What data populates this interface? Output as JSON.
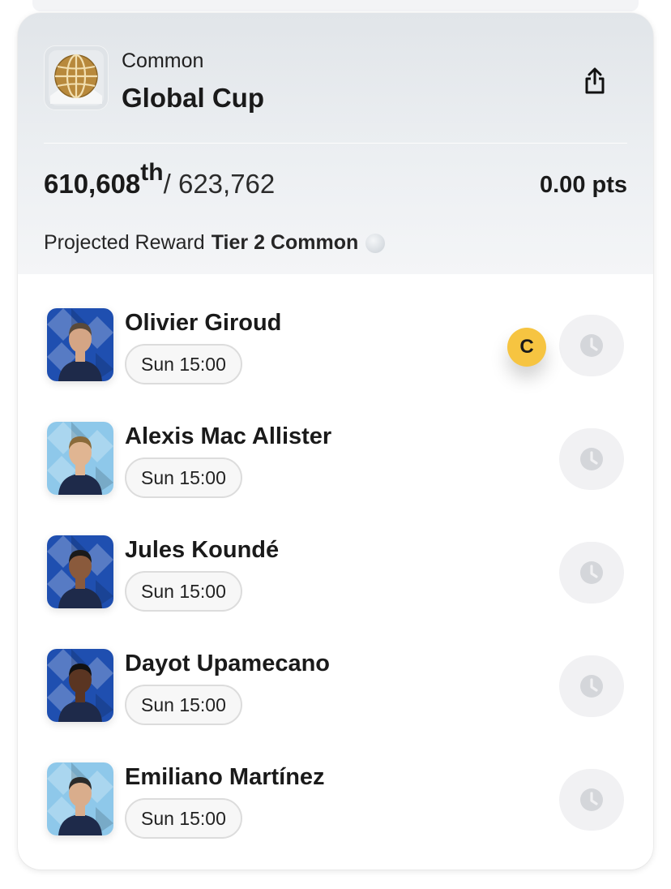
{
  "competition": {
    "rarity": "Common",
    "title": "Global Cup",
    "rank": "610,608",
    "rank_suffix": "th",
    "rank_total": "/ 623,762",
    "points": "0.00 pts",
    "reward_label": "Projected Reward",
    "reward_tier": "Tier 2 Common",
    "logo_icon": "globe-trophy-icon",
    "share_icon": "share-icon"
  },
  "players": [
    {
      "name": "Olivier Giroud",
      "kickoff": "Sun 15:00",
      "captain": "C",
      "card_color": "#1f4fb0",
      "status_icon": "clock-icon"
    },
    {
      "name": "Alexis Mac Allister",
      "kickoff": "Sun 15:00",
      "card_color": "#8ec8ea",
      "status_icon": "clock-icon"
    },
    {
      "name": "Jules Koundé",
      "kickoff": "Sun 15:00",
      "card_color": "#1f4fb0",
      "status_icon": "clock-icon"
    },
    {
      "name": "Dayot Upamecano",
      "kickoff": "Sun 15:00",
      "card_color": "#1f4fb0",
      "status_icon": "clock-icon"
    },
    {
      "name": "Emiliano Martínez",
      "kickoff": "Sun 15:00",
      "card_color": "#8ec8ea",
      "status_icon": "clock-icon"
    }
  ],
  "colors": {
    "header_bg": "#e1e5e9",
    "captain": "#f6c441",
    "chip_border": "#dcdcdc",
    "status_bg": "#f1f1f3"
  }
}
